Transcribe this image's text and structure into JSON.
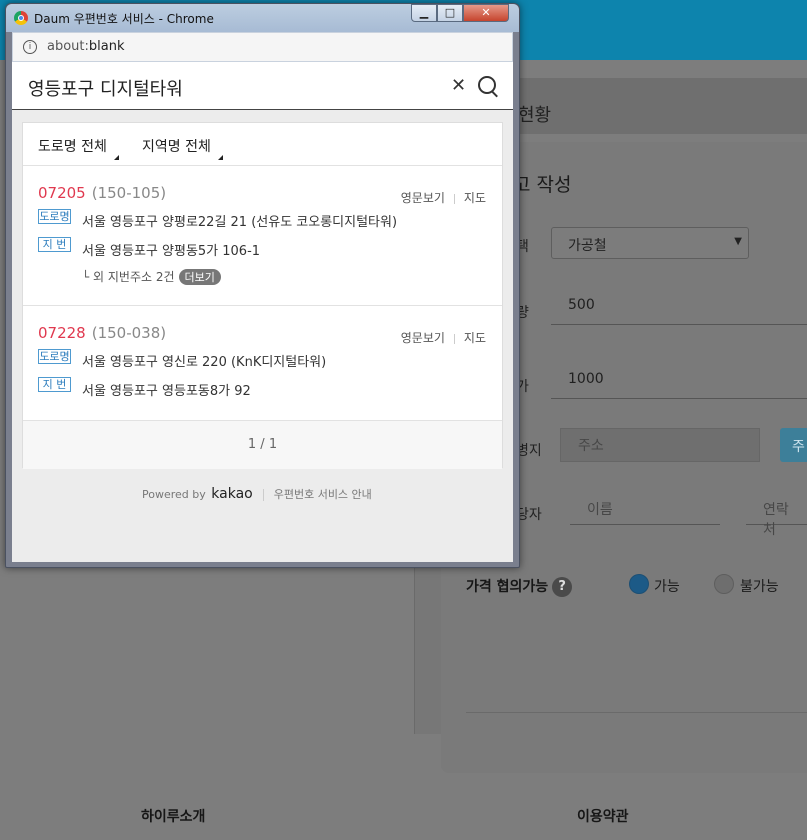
{
  "window": {
    "title": "Daum 우편번호 서비스 - Chrome",
    "url_prefix": "about:",
    "url_main": "blank",
    "minimize": "▁",
    "maximize": "□",
    "close": "✕"
  },
  "search": {
    "value": "영등포구 디지털타워"
  },
  "filters": [
    "도로명 전체",
    "지역명 전체"
  ],
  "results": [
    {
      "zip": "07205",
      "old_zip": "(150-105)",
      "eng_view": "영문보기",
      "map": "지도",
      "road_tag": "도로명",
      "road_addr": "서울 영등포구 양평로22길 21 (선유도 코오롱디지털타워)",
      "jibun_tag": "지 번",
      "jibun_addr": "서울 영등포구 양평동5가 106-1",
      "extra_prefix": "└ 외 지번주소 2건",
      "extra_btn": "더보기"
    },
    {
      "zip": "07228",
      "old_zip": "(150-038)",
      "eng_view": "영문보기",
      "map": "지도",
      "road_tag": "도로명",
      "road_addr": "서울 영등포구 영신로 220 (KnK디지털타워)",
      "jibun_tag": "지 번",
      "jibun_addr": "서울 영등포구 영등포동8가 92"
    }
  ],
  "pager": "1 / 1",
  "footer_popup": {
    "powered": "Powered by",
    "brand": "kakao",
    "guide": "우편번호 서비스 안내"
  },
  "background": {
    "section_title": "현황",
    "card_title": "고 작성",
    "labels": [
      "택",
      "량",
      "가",
      "병지",
      "당자"
    ],
    "material_select": "가공철",
    "quantity": "500",
    "price": "1000",
    "address_placeholder": "주소",
    "address_button": "주",
    "name_placeholder": "이름",
    "contact_placeholder": "연락처",
    "negotiable_label": "가격 협의가능",
    "help": "?",
    "radio_yes": "가능",
    "radio_no": "불가능",
    "footer_left": "하이루소개",
    "footer_right": "이용약관"
  }
}
